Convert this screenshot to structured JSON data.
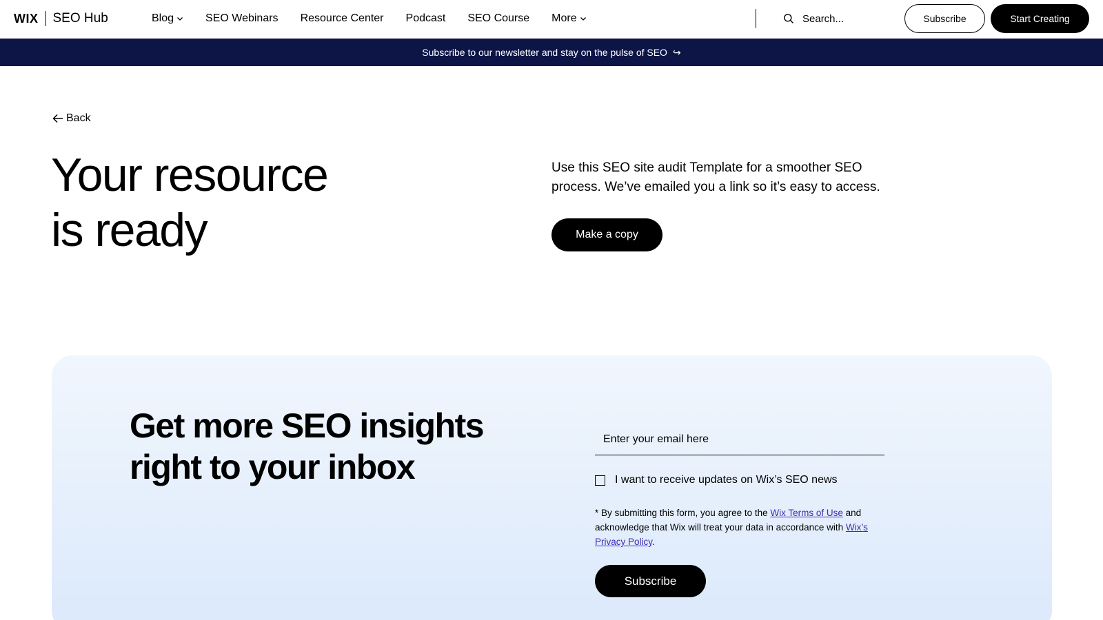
{
  "header": {
    "logo_brand": "WIX",
    "logo_product": "SEO Hub",
    "nav": [
      {
        "label": "Blog",
        "has_dropdown": true
      },
      {
        "label": "SEO Webinars",
        "has_dropdown": false
      },
      {
        "label": "Resource Center",
        "has_dropdown": false
      },
      {
        "label": "Podcast",
        "has_dropdown": false
      },
      {
        "label": "SEO Course",
        "has_dropdown": false
      },
      {
        "label": "More",
        "has_dropdown": true
      }
    ],
    "search_placeholder": "Search...",
    "subscribe_label": "Subscribe",
    "start_label": "Start Creating"
  },
  "banner": {
    "text": "Subscribe to our newsletter and stay on the pulse of SEO",
    "arrow": "↪"
  },
  "hero": {
    "back_label": "Back",
    "title_line1": "Your resource",
    "title_line2": "is ready",
    "description": "Use this SEO site audit Template for a smoother SEO process. We’ve emailed you a link so it’s easy to access.",
    "copy_button": "Make a copy"
  },
  "newsletter": {
    "title_line1": "Get more SEO insights",
    "title_line2": "right to your inbox",
    "email_placeholder": "Enter your email here",
    "checkbox_label": "I want to receive updates on Wix’s SEO news",
    "legal_prefix": "* By submitting this form, you agree to the ",
    "terms_link": "Wix Terms of Use",
    "legal_middle": " and acknowledge that Wix will treat your data in accordance with ",
    "privacy_link": "Wix’s Privacy Policy",
    "legal_suffix": ".",
    "subscribe_button": "Subscribe"
  },
  "colors": {
    "banner_bg": "#0d1547",
    "link": "#3d2bb3",
    "card_top": "#f1f6fd",
    "card_bottom": "#dbe9fb"
  }
}
